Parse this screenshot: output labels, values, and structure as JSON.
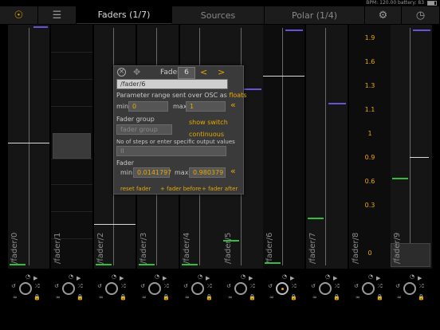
{
  "status": {
    "text": "BPM: 120.00  battery: 83"
  },
  "tabs": [
    {
      "label": "",
      "icon": "gear-like-circle-icon"
    },
    {
      "label": "",
      "icon": "sliders-icon"
    },
    {
      "label": "Faders (1/7)"
    },
    {
      "label": "Sources"
    },
    {
      "label": "Polar (1/4)"
    },
    {
      "label": "",
      "icon": "gear-icon"
    },
    {
      "label": "",
      "icon": "clock-icon"
    }
  ],
  "faders": [
    {
      "label": "/fader/0"
    },
    {
      "label": "/fader/1"
    },
    {
      "label": "/fader/2"
    },
    {
      "label": "/fader/3"
    },
    {
      "label": "/fader/4"
    },
    {
      "label": "/fader/5"
    },
    {
      "label": "/fader/6"
    },
    {
      "label": "/fader/7"
    },
    {
      "label": "/fader/8"
    },
    {
      "label": "/fader/9"
    }
  ],
  "scale": [
    "1.9",
    "1.6",
    "1.3",
    "1.1",
    "1",
    "0.9",
    "0.6",
    "0.3",
    "0"
  ],
  "panel": {
    "fader_label": "Fader",
    "fader_number": "6",
    "prev": "<",
    "next": ">",
    "path": "/fader/6",
    "range_text": "Parameter range sent over OSC as",
    "range_mode": "floats",
    "min_label": "min",
    "min_value": "0",
    "max_label": "max",
    "max_value": "1",
    "chevron": "«",
    "group_label": "Fader group",
    "group_placeholder": "fader group",
    "show_switch": "show switch",
    "continuous": "continuous",
    "steps_text": "No of steps or enter specific output values",
    "steps_placeholder": "II",
    "fader_section": "Fader",
    "fmin_label": "min",
    "fmin_value": "0.0141797",
    "fmax_label": "max",
    "fmax_value": "0.980379",
    "reset": "reset fader",
    "add_before": "+ fader before",
    "add_after": "+ fader after"
  }
}
